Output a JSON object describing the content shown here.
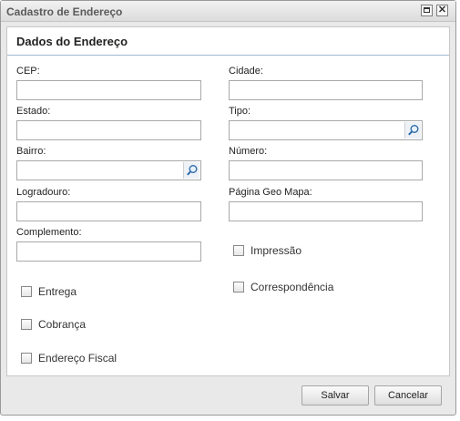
{
  "window": {
    "title": "Cadastro de Endereço"
  },
  "panel": {
    "title": "Dados do Endereço"
  },
  "fields": {
    "cep": {
      "label": "CEP:",
      "value": ""
    },
    "cidade": {
      "label": "Cidade:",
      "value": ""
    },
    "estado": {
      "label": "Estado:",
      "value": ""
    },
    "tipo": {
      "label": "Tipo:",
      "value": ""
    },
    "bairro": {
      "label": "Bairro:",
      "value": ""
    },
    "numero": {
      "label": "Número:",
      "value": ""
    },
    "logradouro": {
      "label": "Logradouro:",
      "value": ""
    },
    "geomapa": {
      "label": "Página Geo Mapa:",
      "value": ""
    },
    "complemento": {
      "label": "Complemento:",
      "value": ""
    }
  },
  "checkboxes": {
    "impressao": {
      "label": "Impressão",
      "checked": false
    },
    "correspondencia": {
      "label": "Correspondência",
      "checked": false
    },
    "entrega": {
      "label": "Entrega",
      "checked": false
    },
    "cobranca": {
      "label": "Cobrança",
      "checked": false
    },
    "fiscal": {
      "label": "Endereço Fiscal",
      "checked": false
    }
  },
  "buttons": {
    "save": "Salvar",
    "cancel": "Cancelar"
  },
  "icons": {
    "maximize": "maximize-icon",
    "close": "close-icon",
    "lookup": "magnifier-icon"
  }
}
